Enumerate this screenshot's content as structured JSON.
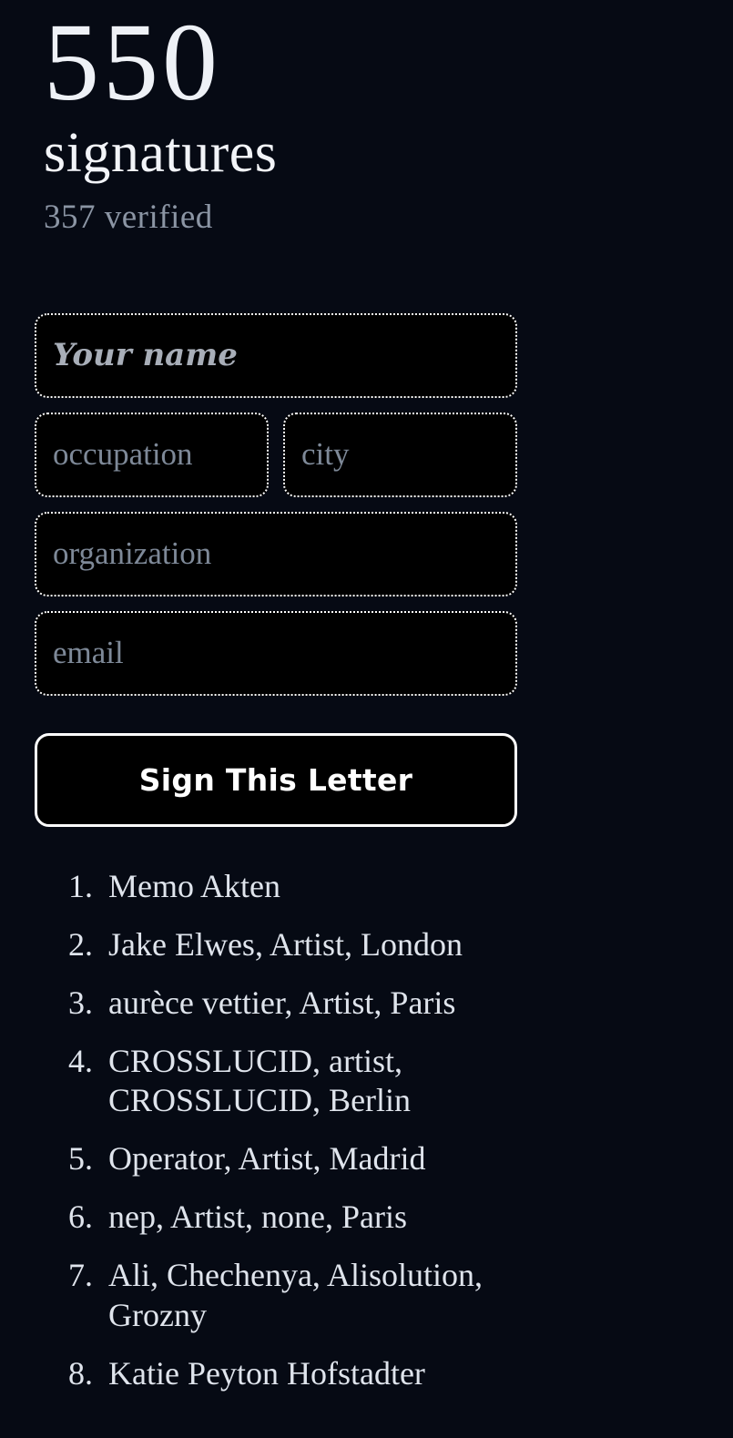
{
  "header": {
    "count": "550",
    "count_word": "signatures",
    "verified": "357 verified"
  },
  "form": {
    "name_placeholder": "Your name",
    "occupation_placeholder": "occupation",
    "city_placeholder": "city",
    "organization_placeholder": "organization",
    "email_placeholder": "email",
    "name_value": "",
    "occupation_value": "",
    "city_value": "",
    "organization_value": "",
    "email_value": "",
    "submit_label": "Sign This Letter"
  },
  "signatures": [
    "Memo Akten",
    "Jake Elwes, Artist, London",
    "aurèce vettier, Artist, Paris",
    "CROSSLUCID, artist, CROSSLUCID, Berlin",
    "Operator, Artist, Madrid",
    "nep, Artist, none, Paris",
    "Ali, Chechenya, Alisolution, Grozny",
    "Katie Peyton Hofstadter"
  ],
  "colors": {
    "background": "#060a14",
    "field_background": "#000000",
    "border": "#ffffff",
    "heading_text": "#eef1f6",
    "muted_text": "#8b95a4",
    "placeholder_text": "#7e8998",
    "list_text": "#dfe4ec"
  }
}
